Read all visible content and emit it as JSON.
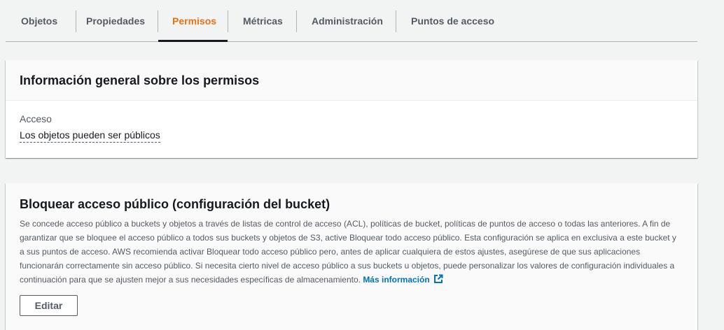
{
  "tabs": [
    {
      "label": "Objetos",
      "active": false
    },
    {
      "label": "Propiedades",
      "active": false
    },
    {
      "label": "Permisos",
      "active": true
    },
    {
      "label": "Métricas",
      "active": false
    },
    {
      "label": "Administración",
      "active": false
    },
    {
      "label": "Puntos de acceso",
      "active": false
    }
  ],
  "overview": {
    "title": "Información general sobre los permisos",
    "access_label": "Acceso",
    "access_value": "Los objetos pueden ser públicos"
  },
  "block_public": {
    "title": "Bloquear acceso público (configuración del bucket)",
    "description": "Se concede acceso público a buckets y objetos a través de listas de control de acceso (ACL), políticas de bucket, políticas de puntos de acceso o todas las anteriores. A fin de garantizar que se bloquee el acceso público a todos sus buckets y objetos de S3, active Bloquear todo acceso público. Esta configuración se aplica en exclusiva a este bucket y a sus puntos de acceso. AWS recomienda activar Bloquear todo acceso público pero, antes de aplicar cualquiera de estos ajustes, asegúrese de que sus aplicaciones funcionarán correctamente sin acceso público. Si necesita cierto nivel de acceso público a sus buckets u objetos, puede personalizar los valores de configuración individuales a continuación para que se ajusten mejor a sus necesidades específicas de almacenamiento.",
    "learn_more": "Más información",
    "learn_more_icon": "external-link-icon",
    "edit_label": "Editar"
  },
  "colors": {
    "active_tab": "#ec7211",
    "link": "#0073bb",
    "background": "#f2f3f3"
  }
}
